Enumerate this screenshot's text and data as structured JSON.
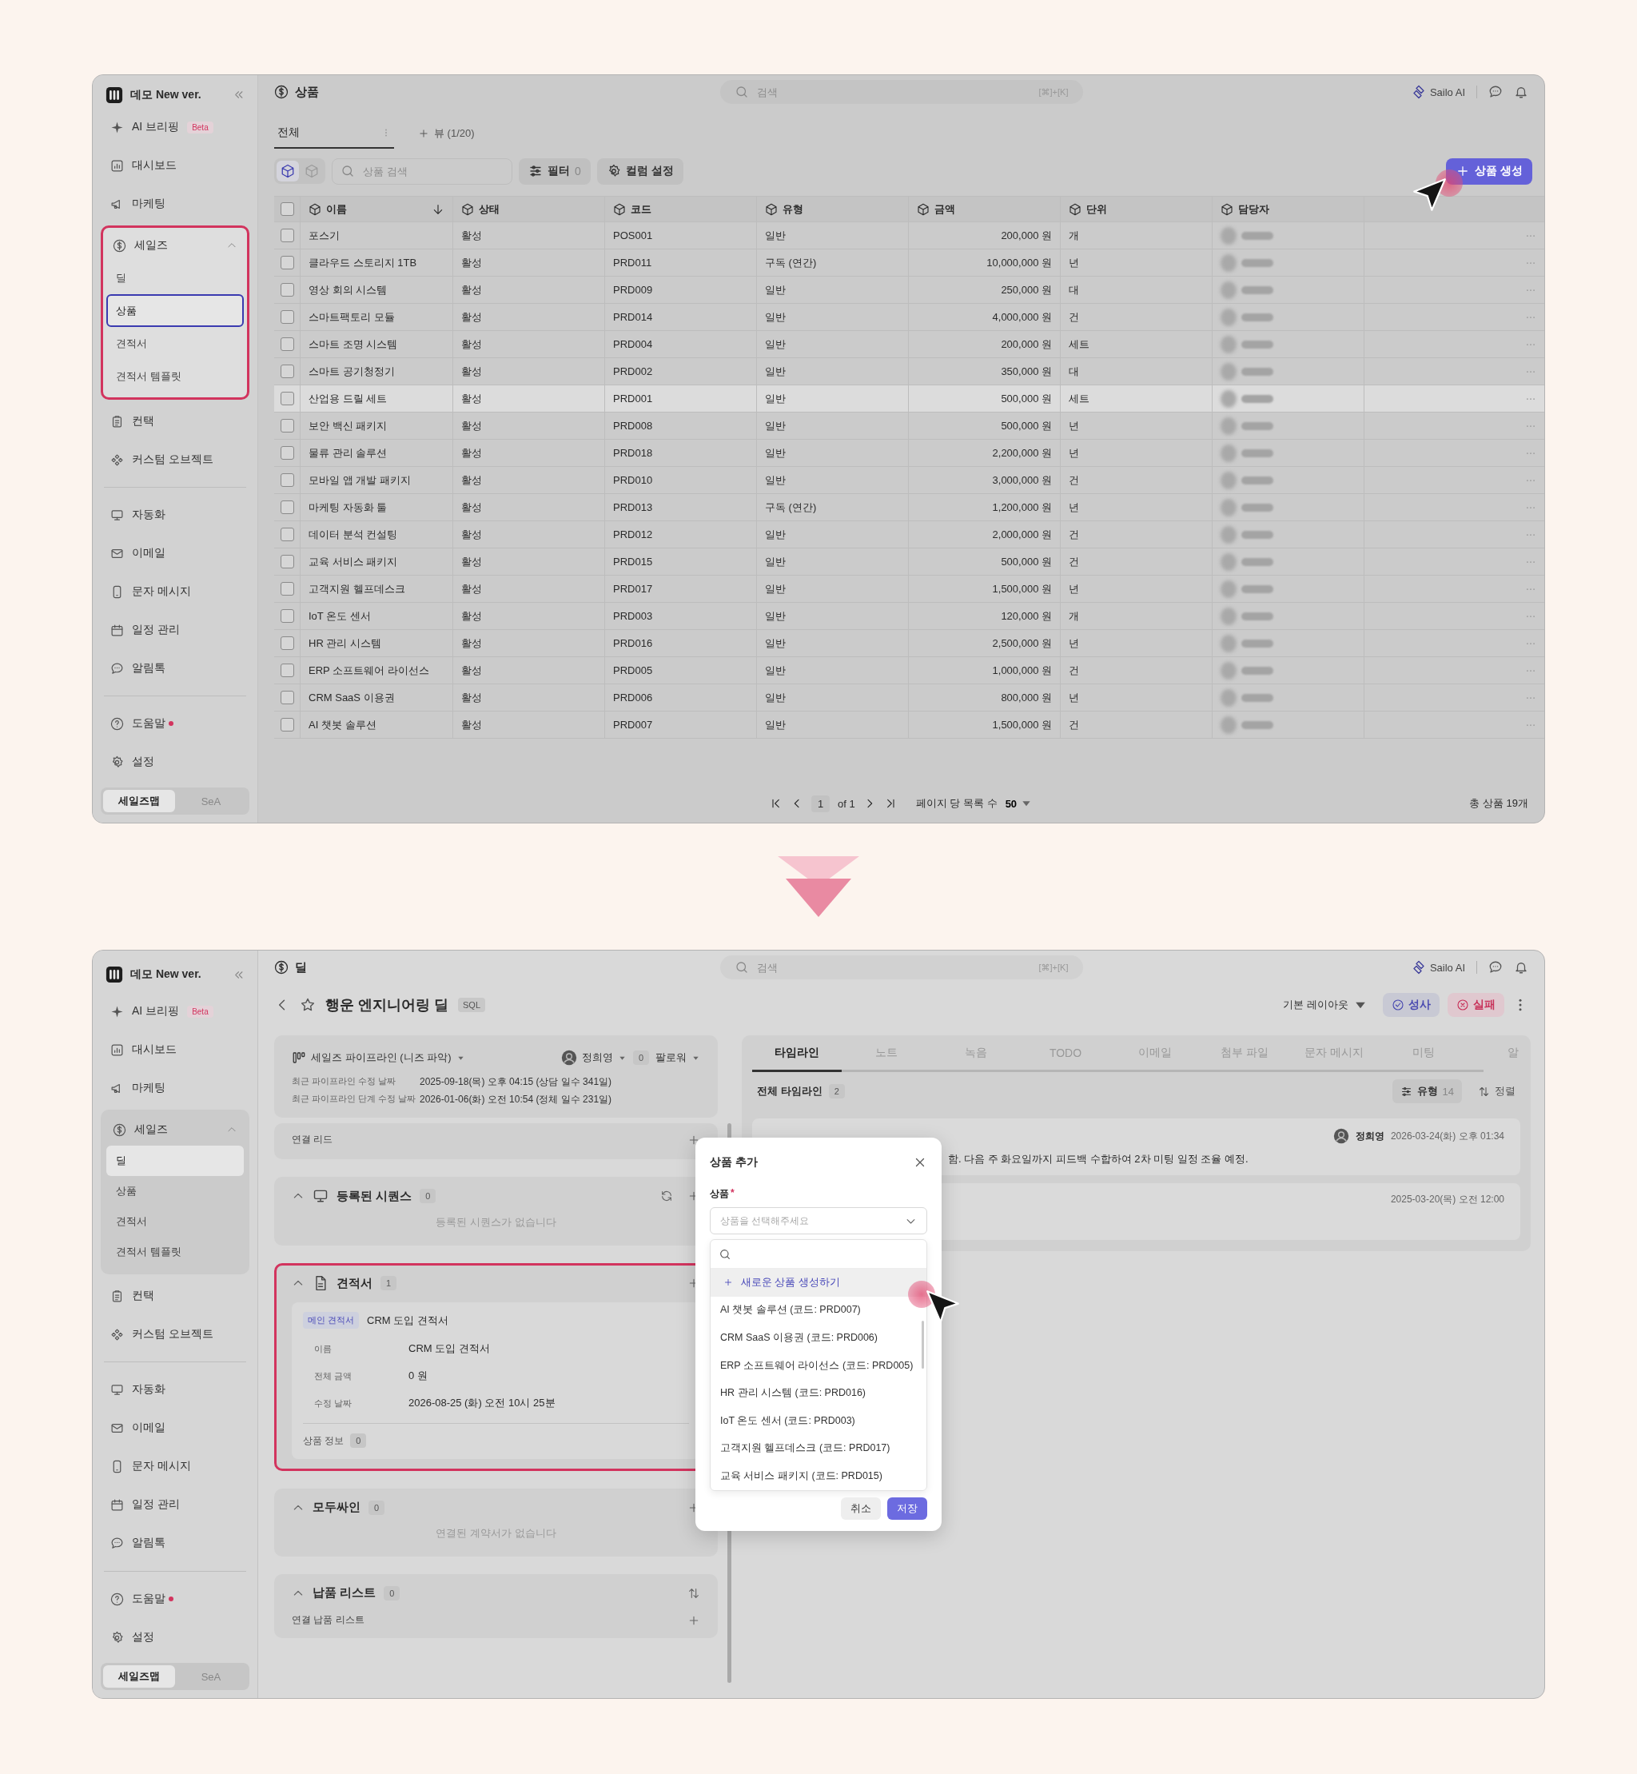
{
  "screens": [
    {
      "kind": "product_list",
      "sidebar": {
        "brand": "데모 New ver.",
        "sections": [
          {
            "items": [
              {
                "kind": "briefing",
                "label": "AI 브리핑",
                "badge": "Beta"
              },
              {
                "kind": "dashboard",
                "label": "대시보드"
              },
              {
                "kind": "marketing",
                "label": "마케팅"
              },
              {
                "kind": "sales",
                "label": "세일즈",
                "expanded": true,
                "highlighted": true,
                "children": [
                  {
                    "label": "딜",
                    "selected": false,
                    "focused": false
                  },
                  {
                    "label": "상품",
                    "selected": true,
                    "focused": true
                  },
                  {
                    "label": "견적서",
                    "selected": false,
                    "focused": false
                  },
                  {
                    "label": "견적서 템플릿",
                    "selected": false,
                    "focused": false
                  }
                ]
              },
              {
                "kind": "contact",
                "label": "컨택"
              },
              {
                "kind": "custom",
                "label": "커스텀 오브젝트"
              }
            ]
          },
          {
            "items": [
              {
                "kind": "automation",
                "label": "자동화"
              },
              {
                "kind": "email",
                "label": "이메일"
              },
              {
                "kind": "sms",
                "label": "문자 메시지"
              },
              {
                "kind": "calendar",
                "label": "일정 관리"
              },
              {
                "kind": "alimtalk",
                "label": "알림톡"
              }
            ]
          },
          {
            "items": [
              {
                "kind": "help",
                "label": "도움말",
                "alert": true
              },
              {
                "kind": "settings",
                "label": "설정",
                "alert": false
              }
            ]
          }
        ],
        "app_switch": [
          {
            "label": "세일즈맵",
            "selected": true
          },
          {
            "label": "SeA",
            "selected": false
          }
        ]
      },
      "topbar": {
        "title": "상품",
        "search_placeholder": "검색",
        "shortcut": "[⌘]+[K]",
        "brand": "Sailo AI"
      },
      "view_tabs": [
        {
          "label": "전체",
          "selected": true
        }
      ],
      "add_view": "뷰 (1/20)",
      "toolbar": {
        "view_modes": [
          {
            "selected": true
          },
          {
            "selected": false
          }
        ],
        "search_placeholder": "상품 검색",
        "filter_label": "필터",
        "filter_count": "0",
        "columns_label": "컬럼 설정",
        "create_label": "상품 생성"
      },
      "table": {
        "all_checked": false,
        "columns": [
          {
            "label": "이름",
            "sorted": true
          },
          {
            "label": "상태",
            "sorted": false
          },
          {
            "label": "코드",
            "sorted": false
          },
          {
            "label": "유형",
            "sorted": false
          },
          {
            "label": "금액",
            "sorted": false
          },
          {
            "label": "단위",
            "sorted": false
          },
          {
            "label": "담당자",
            "sorted": false
          }
        ],
        "rows": [
          {
            "name": "포스기",
            "status": "활성",
            "code": "POS001",
            "type": "일반",
            "amount": "200,000 원",
            "unit": "개",
            "checked": false,
            "hovered": false
          },
          {
            "name": "클라우드 스토리지 1TB",
            "status": "활성",
            "code": "PRD011",
            "type": "구독 (연간)",
            "amount": "10,000,000 원",
            "unit": "년",
            "checked": false,
            "hovered": false
          },
          {
            "name": "영상 회의 시스템",
            "status": "활성",
            "code": "PRD009",
            "type": "일반",
            "amount": "250,000 원",
            "unit": "대",
            "checked": false,
            "hovered": false
          },
          {
            "name": "스마트팩토리 모듈",
            "status": "활성",
            "code": "PRD014",
            "type": "일반",
            "amount": "4,000,000 원",
            "unit": "건",
            "checked": false,
            "hovered": false
          },
          {
            "name": "스마트 조명 시스템",
            "status": "활성",
            "code": "PRD004",
            "type": "일반",
            "amount": "200,000 원",
            "unit": "세트",
            "checked": false,
            "hovered": false
          },
          {
            "name": "스마트 공기청정기",
            "status": "활성",
            "code": "PRD002",
            "type": "일반",
            "amount": "350,000 원",
            "unit": "대",
            "checked": false,
            "hovered": false
          },
          {
            "name": "산업용 드릴 세트",
            "status": "활성",
            "code": "PRD001",
            "type": "일반",
            "amount": "500,000 원",
            "unit": "세트",
            "checked": false,
            "hovered": true
          },
          {
            "name": "보안 백신 패키지",
            "status": "활성",
            "code": "PRD008",
            "type": "일반",
            "amount": "500,000 원",
            "unit": "년",
            "checked": false,
            "hovered": false
          },
          {
            "name": "물류 관리 솔루션",
            "status": "활성",
            "code": "PRD018",
            "type": "일반",
            "amount": "2,200,000 원",
            "unit": "년",
            "checked": false,
            "hovered": false
          },
          {
            "name": "모바일 앱 개발 패키지",
            "status": "활성",
            "code": "PRD010",
            "type": "일반",
            "amount": "3,000,000 원",
            "unit": "건",
            "checked": false,
            "hovered": false
          },
          {
            "name": "마케팅 자동화 툴",
            "status": "활성",
            "code": "PRD013",
            "type": "구독 (연간)",
            "amount": "1,200,000 원",
            "unit": "년",
            "checked": false,
            "hovered": false
          },
          {
            "name": "데이터 분석 컨설팅",
            "status": "활성",
            "code": "PRD012",
            "type": "일반",
            "amount": "2,000,000 원",
            "unit": "건",
            "checked": false,
            "hovered": false
          },
          {
            "name": "교육 서비스 패키지",
            "status": "활성",
            "code": "PRD015",
            "type": "일반",
            "amount": "500,000 원",
            "unit": "건",
            "checked": false,
            "hovered": false
          },
          {
            "name": "고객지원 헬프데스크",
            "status": "활성",
            "code": "PRD017",
            "type": "일반",
            "amount": "1,500,000 원",
            "unit": "년",
            "checked": false,
            "hovered": false
          },
          {
            "name": "IoT 온도 센서",
            "status": "활성",
            "code": "PRD003",
            "type": "일반",
            "amount": "120,000 원",
            "unit": "개",
            "checked": false,
            "hovered": false
          },
          {
            "name": "HR 관리 시스템",
            "status": "활성",
            "code": "PRD016",
            "type": "일반",
            "amount": "2,500,000 원",
            "unit": "년",
            "checked": false,
            "hovered": false
          },
          {
            "name": "ERP 소프트웨어 라이선스",
            "status": "활성",
            "code": "PRD005",
            "type": "일반",
            "amount": "1,000,000 원",
            "unit": "건",
            "checked": false,
            "hovered": false
          },
          {
            "name": "CRM SaaS 이용권",
            "status": "활성",
            "code": "PRD006",
            "type": "일반",
            "amount": "800,000 원",
            "unit": "년",
            "checked": false,
            "hovered": false
          },
          {
            "name": "AI 챗봇 솔루션",
            "status": "활성",
            "code": "PRD007",
            "type": "일반",
            "amount": "1,500,000 원",
            "unit": "건",
            "checked": false,
            "hovered": false
          }
        ]
      },
      "pagination": {
        "page": "1",
        "of_label": "of 1",
        "per_page_label": "페이지 당 목록 수",
        "per_page": "50",
        "total": "총 상품 19개"
      }
    },
    {
      "kind": "deal_detail",
      "sidebar": {
        "brand": "데모 New ver.",
        "sections": [
          {
            "items": [
              {
                "kind": "briefing",
                "label": "AI 브리핑",
                "badge": "Beta"
              },
              {
                "kind": "dashboard",
                "label": "대시보드"
              },
              {
                "kind": "marketing",
                "label": "마케팅"
              },
              {
                "kind": "sales",
                "label": "세일즈",
                "expanded": true,
                "highlighted": false,
                "children": [
                  {
                    "label": "딜",
                    "selected": true,
                    "focused": false
                  },
                  {
                    "label": "상품",
                    "selected": false,
                    "focused": false
                  },
                  {
                    "label": "견적서",
                    "selected": false,
                    "focused": false
                  },
                  {
                    "label": "견적서 템플릿",
                    "selected": false,
                    "focused": false
                  }
                ]
              },
              {
                "kind": "contact",
                "label": "컨택"
              },
              {
                "kind": "custom",
                "label": "커스텀 오브젝트"
              }
            ]
          },
          {
            "items": [
              {
                "kind": "automation",
                "label": "자동화"
              },
              {
                "kind": "email",
                "label": "이메일"
              },
              {
                "kind": "sms",
                "label": "문자 메시지"
              },
              {
                "kind": "calendar",
                "label": "일정 관리"
              },
              {
                "kind": "alimtalk",
                "label": "알림톡"
              }
            ]
          },
          {
            "items": [
              {
                "kind": "help",
                "label": "도움말",
                "alert": true
              },
              {
                "kind": "settings",
                "label": "설정",
                "alert": false
              }
            ]
          }
        ],
        "app_switch": [
          {
            "label": "세일즈맵",
            "selected": true
          },
          {
            "label": "SeA",
            "selected": false
          }
        ]
      },
      "topbar": {
        "title": "딜",
        "search_placeholder": "검색",
        "shortcut": "[⌘]+[K]",
        "brand": "Sailo AI"
      },
      "deal": {
        "title": "행운 엔지니어링 딜",
        "stage_badge": "SQL",
        "starred": false,
        "layout_label": "기본 레이아웃",
        "won_label": "성사",
        "lost_label": "실패"
      },
      "pipeline": {
        "label": "세일즈 파이프라인 (니즈 파악)",
        "owner": "정희영",
        "followers_count": "0",
        "followers_label": "팔로워",
        "facts": [
          {
            "label": "최근 파이프라인 수정 날짜",
            "value": "2025-09-18(목) 오후 04:15 (상담 일수 341일)"
          },
          {
            "label": "최근 파이프라인 단계 수정 날짜",
            "value": "2026-01-06(화) 오전 10:54 (정체 일수 231일)"
          }
        ]
      },
      "cards": [
        {
          "kind": "leads",
          "title": "연결 리드"
        },
        {
          "kind": "sequence",
          "title": "등록된 시퀀스",
          "count": "0",
          "expanded": true,
          "highlighted": false,
          "empty": "등록된 시퀀스가 없습니다"
        },
        {
          "kind": "quote",
          "title": "견적서",
          "count": "1",
          "expanded": true,
          "highlighted": true,
          "main_badge": "메인 견적서",
          "quote_name": "CRM 도입 견적서",
          "fields": [
            {
              "label": "이름",
              "value": "CRM 도입 견적서"
            },
            {
              "label": "전체 금액",
              "value": "0 원"
            },
            {
              "label": "수정 날짜",
              "value": "2026-08-25 (화) 오전 10시 25분"
            }
          ],
          "products_label": "상품 정보",
          "products_count": "0"
        },
        {
          "kind": "contract",
          "title": "모두싸인",
          "count": "0",
          "expanded": true,
          "highlighted": false,
          "empty": "연결된 계약서가 없습니다"
        },
        {
          "kind": "delivery",
          "title": "납품 리스트",
          "count": "0",
          "expanded": true,
          "highlighted": false,
          "sub_label": "연결 납품 리스트"
        }
      ],
      "timeline": {
        "tabs": [
          {
            "label": "타임라인",
            "selected": true
          },
          {
            "label": "노트",
            "selected": false
          },
          {
            "label": "녹음",
            "selected": false
          },
          {
            "label": "TODO",
            "selected": false
          },
          {
            "label": "이메일",
            "selected": false
          },
          {
            "label": "첨부 파일",
            "selected": false
          },
          {
            "label": "문자 메시지",
            "selected": false
          },
          {
            "label": "미팅",
            "selected": false
          },
          {
            "label": "알",
            "selected": false
          }
        ],
        "heading": "전체 타임라인",
        "count": "2",
        "type_filter_label": "유형",
        "type_filter_count": "14",
        "sort_label": "정렬",
        "entries": [
          {
            "author": "정희영",
            "time": "2026-03-24(화) 오후 01:34",
            "text": "함. 다음 주 화요일까지 피드백 수합하여 2차 미팅 일정 조율 예정."
          },
          {
            "time": "2025-03-20(목) 오전 12:00"
          }
        ]
      },
      "dialog": {
        "title": "상품 추가",
        "field_label": "상품",
        "required_mark": "*",
        "placeholder": "상품을 선택해주세요",
        "create_option": "새로운 상품 생성하기",
        "options": [
          "AI 챗봇 솔루션 (코드: PRD007)",
          "CRM SaaS 이용권 (코드: PRD006)",
          "ERP 소프트웨어 라이선스 (코드: PRD005)",
          "HR 관리 시스템 (코드: PRD016)",
          "IoT 온도 센서 (코드: PRD003)",
          "고객지원 헬프데스크 (코드: PRD017)",
          "교육 서비스 패키지 (코드: PRD015)"
        ],
        "cancel_label": "취소",
        "save_label": "저장"
      }
    }
  ]
}
